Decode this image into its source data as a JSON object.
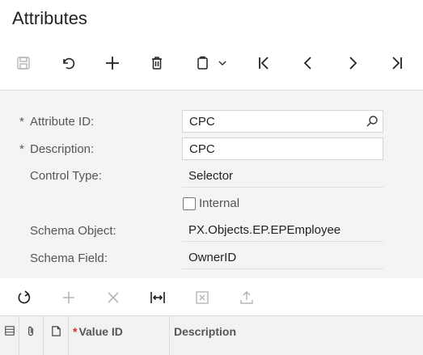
{
  "page": {
    "title": "Attributes"
  },
  "toolbar": {
    "icons": [
      "save-icon",
      "undo-icon",
      "add-icon",
      "delete-icon",
      "copy-paste-icon",
      "chevron-down-icon",
      "first-record-icon",
      "previous-record-icon",
      "next-record-icon",
      "last-record-icon"
    ]
  },
  "form": {
    "required_mark": "*",
    "attribute_id": {
      "label": "Attribute ID:",
      "value": "CPC"
    },
    "description": {
      "label": "Description:",
      "value": "CPC"
    },
    "control_type": {
      "label": "Control Type:",
      "value": "Selector"
    },
    "internal": {
      "label": "Internal",
      "checked": false
    },
    "schema_object": {
      "label": "Schema Object:",
      "value": "PX.Objects.EP.EPEmployee"
    },
    "schema_field": {
      "label": "Schema Field:",
      "value": "OwnerID"
    }
  },
  "grid": {
    "toolbar_icons": [
      "refresh-icon",
      "add-row-icon",
      "delete-row-icon",
      "fit-columns-icon",
      "export-excel-icon",
      "upload-icon"
    ],
    "columns": {
      "required_mark": "*",
      "value_id": "Value ID",
      "description": "Description"
    }
  },
  "colors": {
    "accent": "#222222",
    "disabled": "#b5b5b5",
    "required": "#dd2233",
    "form_bg": "#f4f4f4"
  }
}
